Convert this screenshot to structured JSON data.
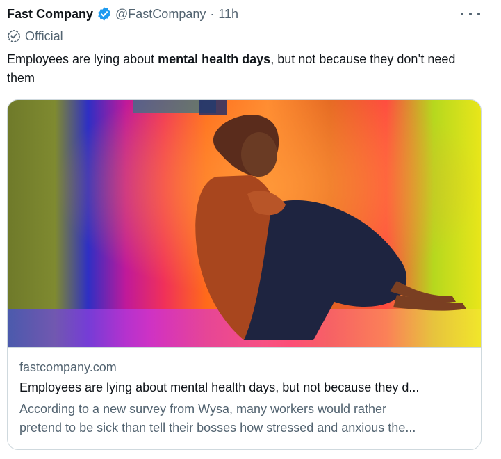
{
  "tweet": {
    "author_name": "Fast Company",
    "handle": "@FastCompany",
    "separator": "·",
    "time": "11h",
    "label": "Official",
    "text_before": "Employees are lying about ",
    "text_bold": "mental health days",
    "text_after": ", but not because they don’t need them"
  },
  "card": {
    "domain": "fastcompany.com",
    "title": "Employees are lying about mental health days, but not because they d...",
    "description_line1": "According to a new survey from Wysa, many workers would rather",
    "description_line2": "pretend to be sick than tell their bosses how stressed and anxious the..."
  },
  "icons": {
    "verified": "verified-badge-icon",
    "official": "check-circle-icon",
    "more": "more-horizontal-icon"
  },
  "colors": {
    "text_primary": "#0f1419",
    "text_secondary": "#536471",
    "verified_blue": "#1d9bf0",
    "border": "#cfd9de"
  }
}
